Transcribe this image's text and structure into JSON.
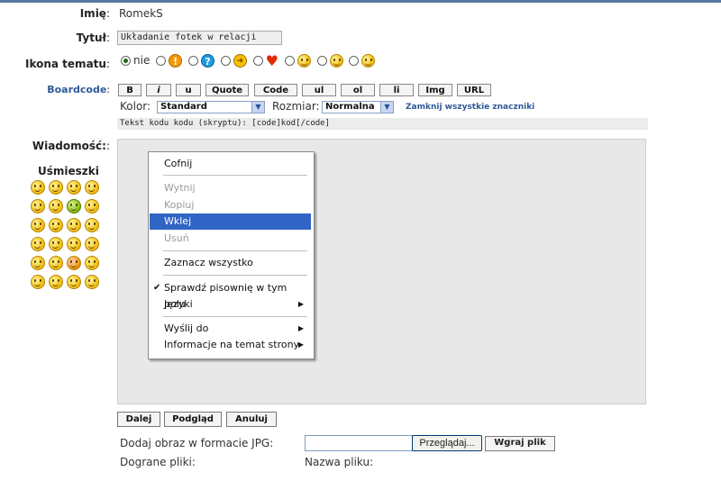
{
  "form": {
    "name_label": "Imię",
    "name_value": "RomekS",
    "title_label": "Tytuł",
    "title_value": "Układanie fotek w relacji",
    "icon_label": "Ikona tematu",
    "icon_none_label": "nie",
    "boardcode_label": "Boardcode",
    "message_label": "Wiadomość:",
    "smileys_label": "Uśmieszki",
    "colon": ":"
  },
  "icons": [
    "warning-icon",
    "question-icon",
    "arrow-right-icon",
    "heart-icon",
    "grin-icon",
    "shocked-icon",
    "smile-icon"
  ],
  "boardcode": {
    "buttons": [
      "B",
      "i",
      "u",
      "Quote",
      "Code",
      "ul",
      "ol",
      "li",
      "Img",
      "URL"
    ],
    "color_label": "Kolor:",
    "color_value": "Standard",
    "size_label": "Rozmiar:",
    "size_value": "Normalna",
    "close_tags": "Zamknij wszystkie znaczniki",
    "help_text": "Tekst kodu kodu (skryptu): [code]kod[/code]"
  },
  "context_menu": {
    "undo": "Cofnij",
    "cut": "Wytnij",
    "copy": "Kopiuj",
    "paste": "Wklej",
    "delete": "Usuń",
    "select_all": "Zaznacz wszystko",
    "spellcheck": "Sprawdź pisownię w tym polu",
    "languages": "Języki",
    "send_to": "Wyślij do",
    "page_info": "Informacje na temat strony"
  },
  "actions": {
    "next": "Dalej",
    "preview": "Podgląd",
    "cancel": "Anuluj"
  },
  "upload": {
    "add_image_label": "Dodaj obraz w formacie JPG:",
    "browse": "Przeglądaj...",
    "upload": "Wgraj plik",
    "uploaded_label": "Dograne pliki:",
    "filename_label": "Nazwa pliku:"
  }
}
